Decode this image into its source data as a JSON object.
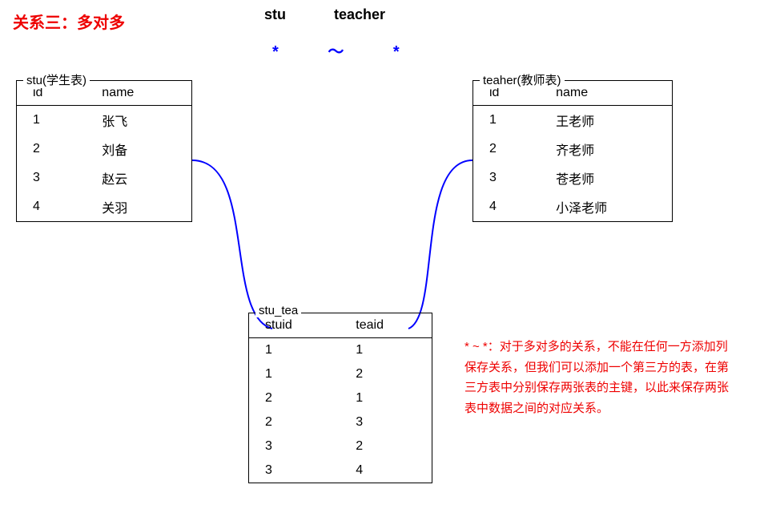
{
  "title": "关系三：多对多",
  "top_labels": {
    "stu": "stu",
    "teacher": "teacher"
  },
  "star_row": "* ～ *",
  "stu_table": {
    "label": "stu(学生表)",
    "columns": [
      "id",
      "name"
    ],
    "rows": [
      [
        "1",
        "张飞"
      ],
      [
        "2",
        "刘备"
      ],
      [
        "3",
        "赵云"
      ],
      [
        "4",
        "关羽"
      ]
    ]
  },
  "teacher_table": {
    "label": "teaher(教师表)",
    "columns": [
      "id",
      "name"
    ],
    "rows": [
      [
        "1",
        "王老师"
      ],
      [
        "2",
        "齐老师"
      ],
      [
        "3",
        "苍老师"
      ],
      [
        "4",
        "小泽老师"
      ]
    ]
  },
  "stutea_table": {
    "label": "stu_tea",
    "columns": [
      "stuid",
      "teaid"
    ],
    "rows": [
      [
        "1",
        "1"
      ],
      [
        "1",
        "2"
      ],
      [
        "2",
        "1"
      ],
      [
        "2",
        "3"
      ],
      [
        "3",
        "2"
      ],
      [
        "3",
        "4"
      ]
    ]
  },
  "description": "* ~ *：对于多对多的关系，不能在任何一方添加列保存关系，但我们可以添加一个第三方的表，在第三方表中分别保存两张表的主键，以此来保存两张表中数据之间的对应关系。"
}
